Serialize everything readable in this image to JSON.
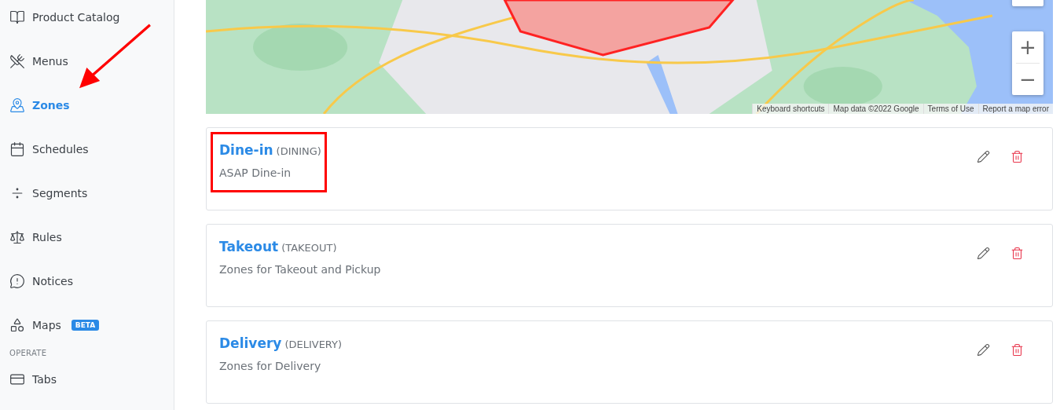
{
  "sidebar": {
    "items": [
      {
        "label": "Product Catalog",
        "selected": false
      },
      {
        "label": "Menus",
        "selected": false
      },
      {
        "label": "Zones",
        "selected": true
      },
      {
        "label": "Schedules",
        "selected": false
      },
      {
        "label": "Segments",
        "selected": false
      },
      {
        "label": "Rules",
        "selected": false
      },
      {
        "label": "Notices",
        "selected": false
      },
      {
        "label": "Maps",
        "selected": false,
        "badge": "BETA"
      }
    ],
    "section": "OPERATE",
    "section_items": [
      {
        "label": "Tabs",
        "selected": false
      }
    ]
  },
  "annotation_arrow": true,
  "map": {
    "kind": "picture",
    "zoom_in": "+",
    "zoom_out": "−",
    "attribution": [
      "Keyboard shortcuts",
      "Map data ©2022 Google",
      "Terms of Use",
      "Report a map error"
    ]
  },
  "zones": [
    {
      "name": "Dine-in",
      "code": "(DINING)",
      "description": "ASAP Dine-in",
      "highlighted": true
    },
    {
      "name": "Takeout",
      "code": "(TAKEOUT)",
      "description": "Zones for Takeout and Pickup",
      "highlighted": false
    },
    {
      "name": "Delivery",
      "code": "(DELIVERY)",
      "description": "Zones for Delivery",
      "highlighted": false
    }
  ]
}
